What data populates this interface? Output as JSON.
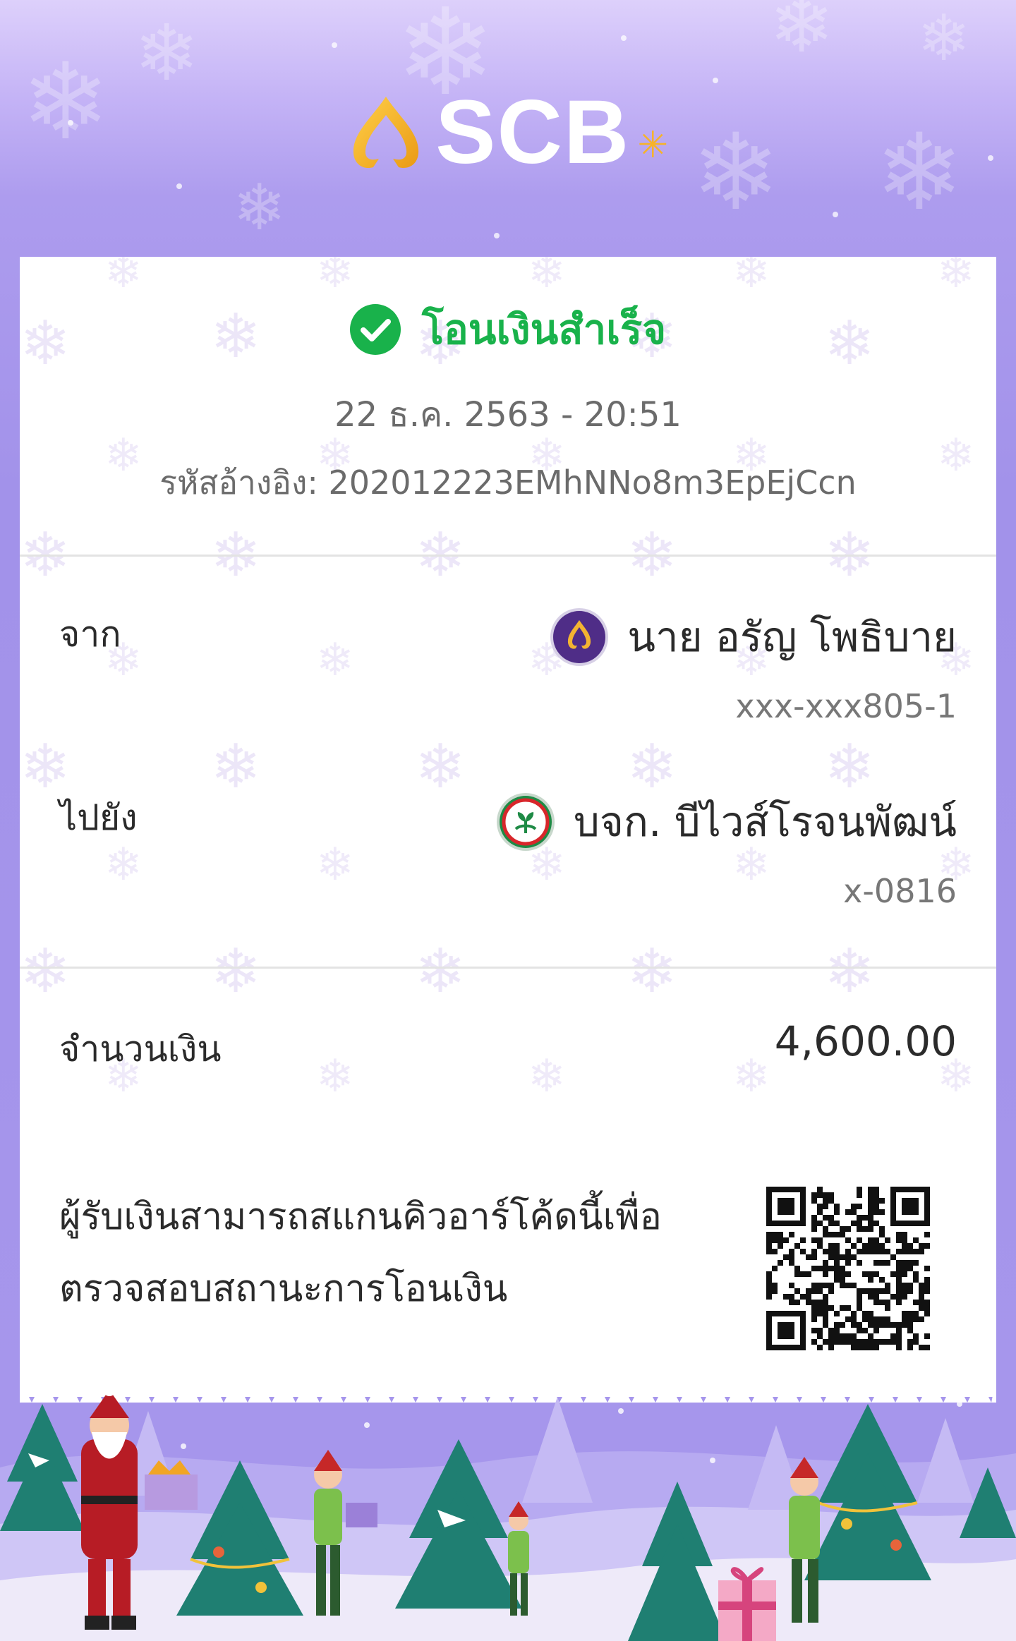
{
  "brand": {
    "name": "SCB",
    "colors": {
      "logo_gold": "#f2b027",
      "success_green": "#19b24b",
      "header_purple": "#a292ea"
    }
  },
  "transfer": {
    "status": "โอนเงินสำเร็จ",
    "datetime": "22 ธ.ค. 2563 - 20:51",
    "reference": "รหัสอ้างอิง: 202012223EMhNNo8m3EpEjCcn",
    "from": {
      "label": "จาก",
      "name": "นาย อรัญ โพธิบาย",
      "account": "xxx-xxx805-1",
      "bank_icon": "scb-bank-icon"
    },
    "to": {
      "label": "ไปยัง",
      "name": "บจก. บีไวส์โรจนพัฒน์",
      "account": "x-0816",
      "bank_icon": "kbank-bank-icon"
    },
    "amount": {
      "label": "จำนวนเงิน",
      "value": "4,600.00"
    },
    "qr_note": "ผู้รับเงินสามารถสแกนคิวอาร์โค้ดนี้เพื่อ ตรวจสอบสถานะการโอนเงิน"
  }
}
